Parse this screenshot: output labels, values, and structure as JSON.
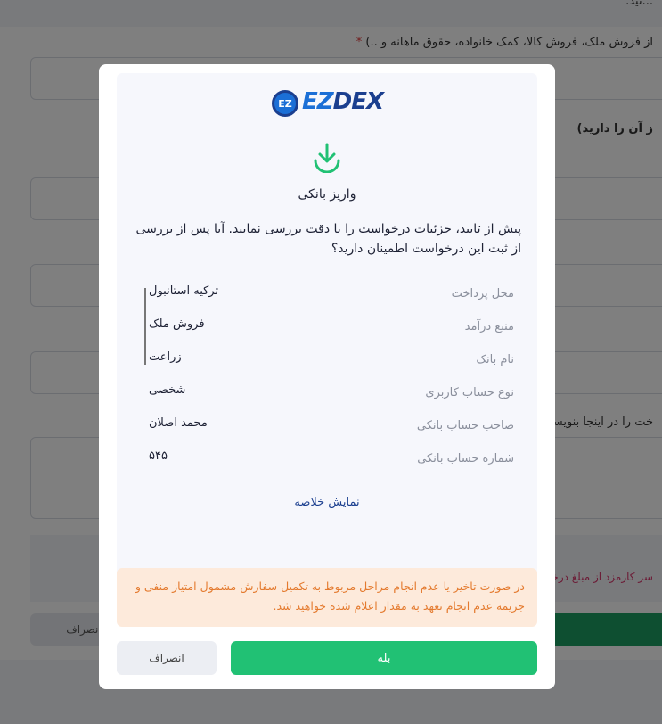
{
  "background": {
    "top_fragment": "...تید.",
    "source_label": "از فروش ملک، فروش کالا، کمک خانواده، حقوق ماهانه و ..)",
    "required_star": "*",
    "section_label": "ز آن را دارید)",
    "description_label": "خت را در اینجا بنویسید",
    "fee_note": "سر کارمزد از مبلغ درخواست",
    "cancel_label": "انصراف"
  },
  "modal": {
    "logo_badge": "EZ",
    "logo_text_ez": "EZ",
    "logo_text_rest": "DEX",
    "icon": "download-icon",
    "title": "واریز بانکی",
    "question": "پیش از تایید، جزئیات درخواست را با دقت بررسی نمایید. آیا پس از بررسی از ثبت این درخواست اطمینان دارید؟",
    "details": [
      {
        "label": "محل پرداخت",
        "value": "ترکیه استانبول"
      },
      {
        "label": "منبع درآمد",
        "value": "فروش ملک"
      },
      {
        "label": "نام بانک",
        "value": "زراعت"
      },
      {
        "label": "نوع حساب کاربری",
        "value": "شخصی"
      },
      {
        "label": "صاحب حساب بانکی",
        "value": "محمد اصلان"
      },
      {
        "label": "شماره حساب بانکی",
        "value": "۵۴۵"
      }
    ],
    "summary_link": "نمایش خلاصه",
    "warning": "در صورت تاخیر یا عدم انجام مراحل مربوط به تکمیل سفارش مشمول امتیاز منفی و جریمه عدم انجام تعهد به مقدار اعلام شده خواهید شد.",
    "confirm_label": "بله",
    "cancel_label": "انصراف"
  },
  "colors": {
    "primary_green": "#21c174",
    "brand_blue": "#1b3f8f",
    "warning_bg": "#fdeadb",
    "warning_text": "#e47a2e"
  }
}
